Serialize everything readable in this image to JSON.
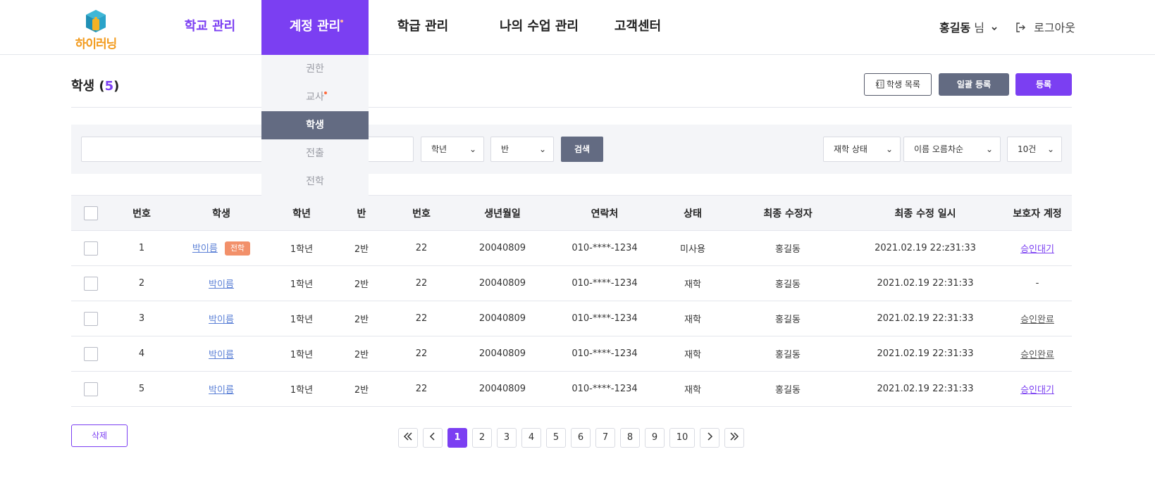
{
  "header": {
    "logo_text": "하이러닝",
    "nav": [
      {
        "label": "학교 관리"
      },
      {
        "label": "계정 관리"
      },
      {
        "label": "학급 관리"
      },
      {
        "label": "나의 수업 관리"
      },
      {
        "label": "고객센터"
      }
    ],
    "user_name": "홍길동",
    "user_suffix": "님",
    "logout_label": "로그아웃"
  },
  "dropdown": {
    "items": [
      {
        "label": "권한"
      },
      {
        "label": "교사"
      },
      {
        "label": "학생"
      },
      {
        "label": "전출"
      },
      {
        "label": "전학"
      }
    ]
  },
  "page": {
    "title": "학생",
    "count": "5",
    "list_button": "학생 목록",
    "bulk_button": "일괄 등록",
    "register_button": "등록"
  },
  "filters": {
    "search_value": "",
    "grade": "학년",
    "class": "반",
    "search_button": "검색",
    "status": "재학 상태",
    "sort": "이름 오름차순",
    "page_size": "10건"
  },
  "table": {
    "headers": [
      "번호",
      "학생",
      "학년",
      "반",
      "번호",
      "생년월일",
      "연락처",
      "상태",
      "최종 수정자",
      "최종 수정 일시",
      "보호자 계정"
    ],
    "rows": [
      {
        "no": "1",
        "name": "박이름",
        "badge": "전학",
        "grade": "1학년",
        "class": "2반",
        "num": "22",
        "birth": "20040809",
        "phone": "010-****-1234",
        "status": "미사용",
        "editor": "홍길동",
        "edited": "2021.02.19 22:z31:33",
        "guardian": "승인대기"
      },
      {
        "no": "2",
        "name": "박이름",
        "badge": "",
        "grade": "1학년",
        "class": "2반",
        "num": "22",
        "birth": "20040809",
        "phone": "010-****-1234",
        "status": "재학",
        "editor": "홍길동",
        "edited": "2021.02.19 22:31:33",
        "guardian": "-"
      },
      {
        "no": "3",
        "name": "박이름",
        "badge": "",
        "grade": "1학년",
        "class": "2반",
        "num": "22",
        "birth": "20040809",
        "phone": "010-****-1234",
        "status": "재학",
        "editor": "홍길동",
        "edited": "2021.02.19 22:31:33",
        "guardian": "승인완료"
      },
      {
        "no": "4",
        "name": "박이름",
        "badge": "",
        "grade": "1학년",
        "class": "2반",
        "num": "22",
        "birth": "20040809",
        "phone": "010-****-1234",
        "status": "재학",
        "editor": "홍길동",
        "edited": "2021.02.19 22:31:33",
        "guardian": "승인완료"
      },
      {
        "no": "5",
        "name": "박이름",
        "badge": "",
        "grade": "1학년",
        "class": "2반",
        "num": "22",
        "birth": "20040809",
        "phone": "010-****-1234",
        "status": "재학",
        "editor": "홍길동",
        "edited": "2021.02.19 22:31:33",
        "guardian": "승인대기"
      }
    ]
  },
  "footer": {
    "delete_button": "삭제",
    "pages": [
      "1",
      "2",
      "3",
      "4",
      "5",
      "6",
      "7",
      "8",
      "9",
      "10"
    ],
    "current_page": "1"
  },
  "colors": {
    "accent": "#7b3ff2",
    "gray_button": "#636b82",
    "badge": "#f2906a",
    "logo": "#f29a1c"
  }
}
